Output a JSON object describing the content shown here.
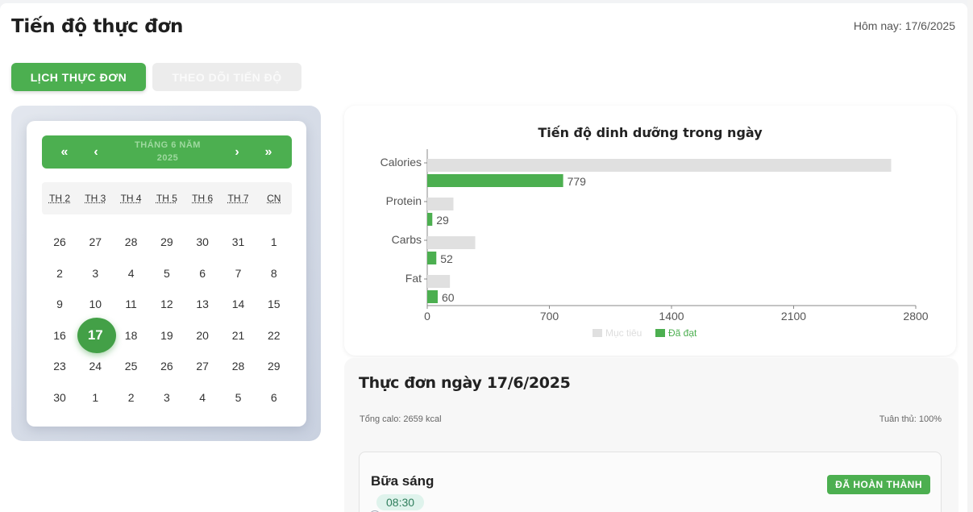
{
  "header": {
    "title": "Tiến độ thực đơn",
    "today": "Hôm nay: 17/6/2025"
  },
  "tabs": [
    {
      "label": "LỊCH THỰC ĐƠN",
      "active": true
    },
    {
      "label": "THEO DÕI TIẾN ĐỘ",
      "active": false
    }
  ],
  "calendar": {
    "prev_year": "«",
    "prev_month": "‹",
    "next_month": "›",
    "next_year": "»",
    "month_line1": "THÁNG 6 NĂM",
    "month_line2": "2025",
    "weekdays": [
      "TH 2",
      "TH 3",
      "TH 4",
      "TH 5",
      "TH 6",
      "TH 7",
      "CN"
    ],
    "weeks": [
      [
        "26",
        "27",
        "28",
        "29",
        "30",
        "31",
        "1"
      ],
      [
        "2",
        "3",
        "4",
        "5",
        "6",
        "7",
        "8"
      ],
      [
        "9",
        "10",
        "11",
        "12",
        "13",
        "14",
        "15"
      ],
      [
        "16",
        "17",
        "18",
        "19",
        "20",
        "21",
        "22"
      ],
      [
        "23",
        "24",
        "25",
        "26",
        "27",
        "28",
        "29"
      ],
      [
        "30",
        "1",
        "2",
        "3",
        "4",
        "5",
        "6"
      ]
    ],
    "selected": "17"
  },
  "chart_data": {
    "type": "bar",
    "orientation": "horizontal",
    "title": "Tiến độ dinh dưỡng trong ngày",
    "categories": [
      "Calories",
      "Protein",
      "Carbs",
      "Fat"
    ],
    "series": [
      {
        "name": "Mục tiêu",
        "values": [
          2659,
          150,
          275,
          130
        ],
        "color": "#e0e0e0"
      },
      {
        "name": "Đã đạt",
        "values": [
          779,
          29,
          52,
          60
        ],
        "color": "#4caf50"
      }
    ],
    "data_labels": [
      "779",
      "29",
      "52",
      "60"
    ],
    "xlim": [
      0,
      2800
    ],
    "xticks": [
      "0",
      "700",
      "1400",
      "2100",
      "2800"
    ],
    "legend": "bottom",
    "grid": false
  },
  "menu": {
    "title": "Thực đơn ngày 17/6/2025",
    "total": "Tổng calo: 2659 kcal",
    "compliance": "Tuân thủ: 100%",
    "meals": [
      {
        "name": "Bữa sáng",
        "time": "08:30",
        "status": "ĐÃ HOÀN THÀNH"
      }
    ]
  },
  "colors": {
    "accent": "#4caf50",
    "target": "#e0e0e0"
  }
}
